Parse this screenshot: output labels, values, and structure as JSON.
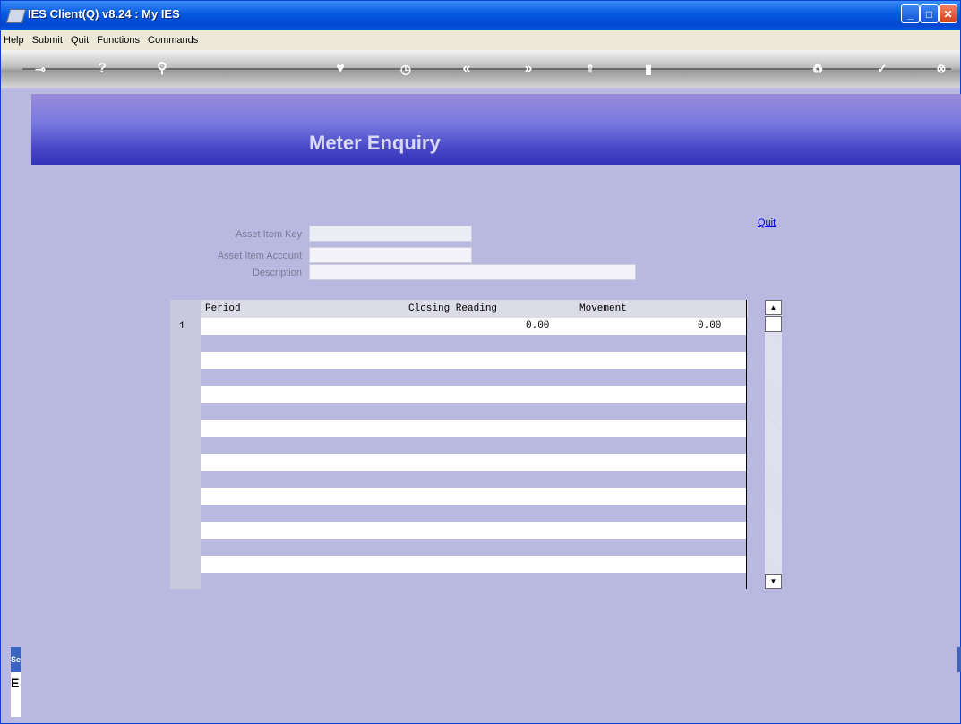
{
  "window": {
    "title": "IES Client(Q) v8.24 : My IES"
  },
  "menubar": {
    "items": [
      "Help",
      "Submit",
      "Quit",
      "Functions",
      "Commands"
    ]
  },
  "toolbar": {
    "icons": [
      "key-icon",
      "help-icon",
      "search-icon",
      "favourite-icon",
      "clock-icon",
      "previous-icon",
      "next-icon",
      "upload-icon",
      "document-icon",
      "recycle-icon",
      "accept-icon",
      "close-icon"
    ]
  },
  "banner": {
    "title": "Meter Enquiry"
  },
  "form": {
    "asset_item_key_label": "Asset Item Key",
    "asset_item_key_value": "",
    "asset_item_account_label": "Asset Item Account",
    "asset_item_account_value": "",
    "description_label": "Description",
    "description_value": "",
    "quit_label": "Quit"
  },
  "grid": {
    "columns": [
      "Period",
      "Closing Reading",
      "Movement"
    ],
    "rows": [
      {
        "num": "1",
        "period": "",
        "closing_reading": "0.00",
        "movement": "0.00"
      }
    ]
  },
  "side": {
    "tab_label": "Ses",
    "box_label": "E"
  },
  "colors": {
    "titlebar": "#0458e0",
    "background": "#b8b8e0",
    "banner": "#4a4ac8",
    "banner_text": "#d8d8f4"
  }
}
